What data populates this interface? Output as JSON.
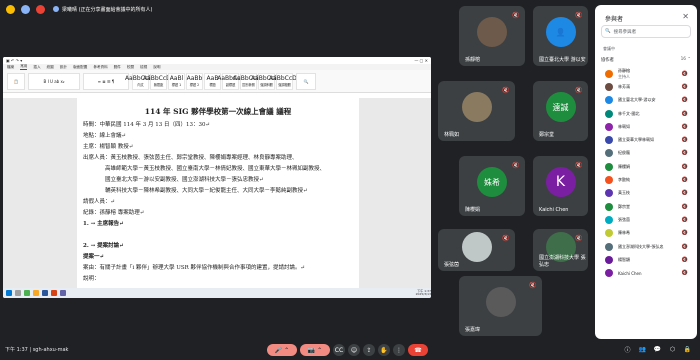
{
  "topbar": {
    "presenter": "梁曦晴 (正在分享畫面給會議中的所有人)"
  },
  "doc": {
    "title": "114 年 SIG 夥伴學校第一次線上會議 議程",
    "lines": [
      "時間：中華民國 114 年 3 月 13 日（四）13：30↵",
      "地點：線上會議↵",
      "主席：楊智穎 教授↵",
      "出席人員：黃玉枝教授、張弦茵主任、鄭宗堂教授、陳櫻娟專案經理、林良靜專案助理、",
      "　　　　高雄師範大學－黃玉枝教授、國立臺南大學－林倩妃教授、國立東華大學－林珮如副教授、",
      "　　　　國立臺北大學－游以安副教授、國立澎湖科技大學－張弘忠教授↵",
      "　　　　輔英科技大學－陳林希副教授、大同大學－紀俊龍主任、大同大學－李懿純副教授↵",
      "請假人員：↵",
      "紀錄：孫靜榕 專案助理↵",
      "1. → 主席報告↵",
      "",
      "2. → 提案討論↵",
      "提案一↵",
      "案由：有關子計畫「i 夥伴」辦理大學 USR 夥伴協作機制與合作事項的建置，提請討論。↵",
      "說明："
    ],
    "tabs": [
      "檔案",
      "常用",
      "插入",
      "繪圖",
      "設計",
      "版面配置",
      "參考資料",
      "郵件",
      "校閱",
      "檢視",
      "說明"
    ],
    "styles": [
      {
        "sample": "AaBbCcDc",
        "name": "內文"
      },
      {
        "sample": "AaBbCcDc",
        "name": "無間距"
      },
      {
        "sample": "AaBl",
        "name": "標題 1"
      },
      {
        "sample": "AaBb",
        "name": "標題 2"
      },
      {
        "sample": "AaB",
        "name": "標題"
      },
      {
        "sample": "AaBbCcL",
        "name": "副標題"
      },
      {
        "sample": "AaBbCcDc",
        "name": "區別參照"
      },
      {
        "sample": "AaBbCcDc",
        "name": "強調斜體"
      },
      {
        "sample": "AaBbCcDc",
        "name": "強調粗體"
      }
    ],
    "taskbar_time": "下午 1:37",
    "taskbar_date": "2025/3/13"
  },
  "tiles": [
    {
      "name": "孫靜榕",
      "avatar": "photo"
    },
    {
      "name": "國立臺北大學 游以安",
      "avatar": "person",
      "color": "#1e88e5"
    },
    {
      "name": "林珮如",
      "avatar": "photo"
    },
    {
      "name": "鄭宗堂",
      "avatar": "遠誠",
      "color": "#1e8e3e"
    },
    {
      "name": "陳櫻娟",
      "avatar": "姝希",
      "color": "#1e8e3e"
    },
    {
      "name": "Kaichi Chen",
      "avatar": "K",
      "color": "#7b1fa2"
    },
    {
      "name": "張弦茵",
      "avatar": "photo"
    },
    {
      "name": "國立澎湖科技大學 張弘忠",
      "avatar": "photo"
    },
    {
      "name": "張嘉瑋",
      "avatar": "photo"
    }
  ],
  "panel": {
    "title": "參與者",
    "search_placeholder": "搜尋參與者",
    "section": "會議中",
    "group_label": "協作者",
    "group_count": "16",
    "people": [
      {
        "name": "孫靜榕",
        "sub": "主持人",
        "color": "#ef6c00"
      },
      {
        "name": "林芳滿",
        "color": "#6d4c41"
      },
      {
        "name": "國立臺北大學-游以安",
        "color": "#1e88e5"
      },
      {
        "name": "林千文-國北",
        "color": "#00897b"
      },
      {
        "name": "林珮如",
        "color": "#8e24aa"
      },
      {
        "name": "國立東華大學林珮如",
        "color": "#3949ab"
      },
      {
        "name": "紀俊龍",
        "color": "#546e7a"
      },
      {
        "name": "陳櫻娟",
        "color": "#1e8e3e"
      },
      {
        "name": "李懿純",
        "color": "#f4511e"
      },
      {
        "name": "黃玉枝",
        "color": "#5e35b1"
      },
      {
        "name": "鄭宗堂",
        "color": "#1e8e3e"
      },
      {
        "name": "張弦茵",
        "color": "#00acc1"
      },
      {
        "name": "陳林希",
        "color": "#c0ca33"
      },
      {
        "name": "國立澎湖科技大學-張弘忠",
        "color": "#546e7a"
      },
      {
        "name": "楊智穎",
        "color": "#6a1b9a"
      },
      {
        "name": "Kaichi Chen",
        "color": "#7b1fa2"
      }
    ]
  },
  "bottombar": {
    "time": "下午 1:37",
    "code": "sgh-ahxu-mak"
  }
}
